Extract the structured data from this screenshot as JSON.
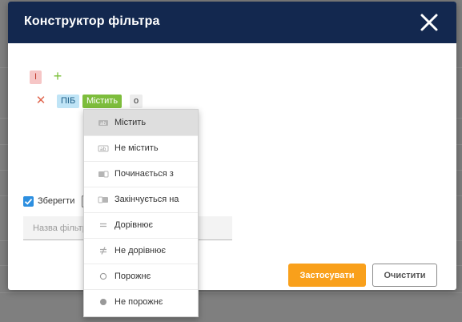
{
  "dialog": {
    "title": "Конструктор фільтра"
  },
  "group": {
    "operator": "І"
  },
  "condition": {
    "field": "ПІБ",
    "operator": "Містить",
    "value": "о"
  },
  "operators_menu": {
    "items": [
      {
        "label": "Містить",
        "icon": "contains-icon",
        "selected": true
      },
      {
        "label": "Не містить",
        "icon": "not-contains-icon",
        "selected": false
      },
      {
        "label": "Починається з",
        "icon": "starts-with-icon",
        "selected": false
      },
      {
        "label": "Закінчується на",
        "icon": "ends-with-icon",
        "selected": false
      },
      {
        "label": "Дорівнює",
        "icon": "equals-icon",
        "selected": false
      },
      {
        "label": "Не дорівнює",
        "icon": "not-equals-icon",
        "selected": false
      },
      {
        "label": "Порожнє",
        "icon": "empty-circle-icon",
        "selected": false
      },
      {
        "label": "Не порожнє",
        "icon": "filled-circle-icon",
        "selected": false
      }
    ]
  },
  "save": {
    "checked": true,
    "label": "Зберегти",
    "name_placeholder": "Назва фільтра"
  },
  "actions": {
    "apply_label": "Застосувати",
    "clear_label": "Очистити"
  },
  "colors": {
    "header_bg": "#13284f",
    "apply_bg": "#f9a01b",
    "operator_chip": "#7dbd3c",
    "field_chip": "#bfe4f6",
    "group_chip": "#f6c6c6",
    "checkbox": "#2d8fe0"
  }
}
